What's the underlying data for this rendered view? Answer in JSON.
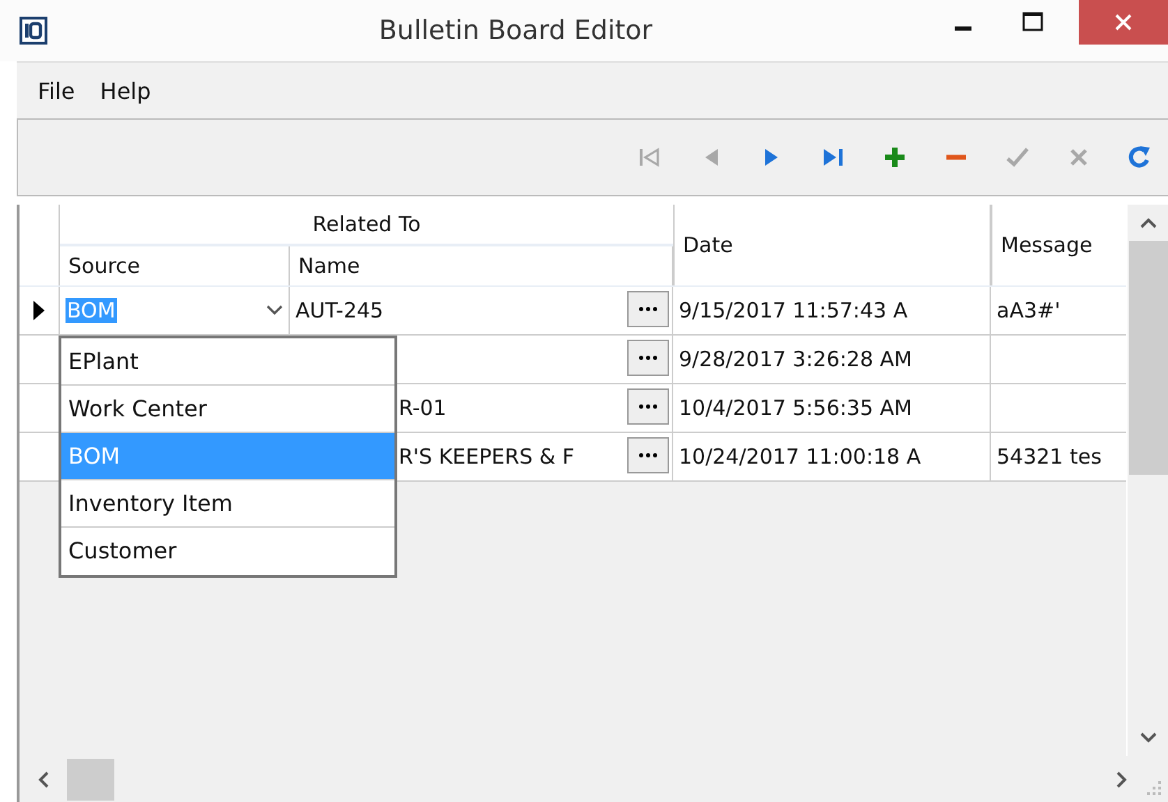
{
  "window": {
    "title": "Bulletin Board Editor"
  },
  "menu": [
    "File",
    "Help"
  ],
  "toolbar": [
    {
      "kind": "first",
      "disabled": true
    },
    {
      "kind": "prior",
      "disabled": true
    },
    {
      "kind": "next",
      "disabled": false
    },
    {
      "kind": "last",
      "disabled": false
    },
    {
      "kind": "add",
      "disabled": false
    },
    {
      "kind": "delete",
      "disabled": false
    },
    {
      "kind": "post",
      "disabled": true
    },
    {
      "kind": "cancel",
      "disabled": true
    },
    {
      "kind": "refresh",
      "disabled": false
    }
  ],
  "table": {
    "group_header": "Related To",
    "columns": [
      "Source",
      "Name",
      "Date",
      "Message"
    ],
    "rows": [
      {
        "current": true,
        "source": "BOM",
        "name": "AUT-245",
        "date": "9/15/2017 11:57:43 A",
        "message": "aA3#'"
      },
      {
        "current": false,
        "name": "",
        "date": "9/28/2017 3:26:28 AM",
        "message": ""
      },
      {
        "current": false,
        "name": "R-01",
        "date": "10/4/2017 5:56:35 AM",
        "message": ""
      },
      {
        "current": false,
        "name": "R'S KEEPERS & F",
        "date": "10/24/2017 11:00:18 A",
        "message": "54321 tes"
      }
    ]
  },
  "dropdown": [
    {
      "label": "EPlant",
      "selected": false
    },
    {
      "label": "Work Center",
      "selected": false
    },
    {
      "label": "BOM",
      "selected": true
    },
    {
      "label": "Inventory Item",
      "selected": false
    },
    {
      "label": "Customer",
      "selected": false
    }
  ]
}
